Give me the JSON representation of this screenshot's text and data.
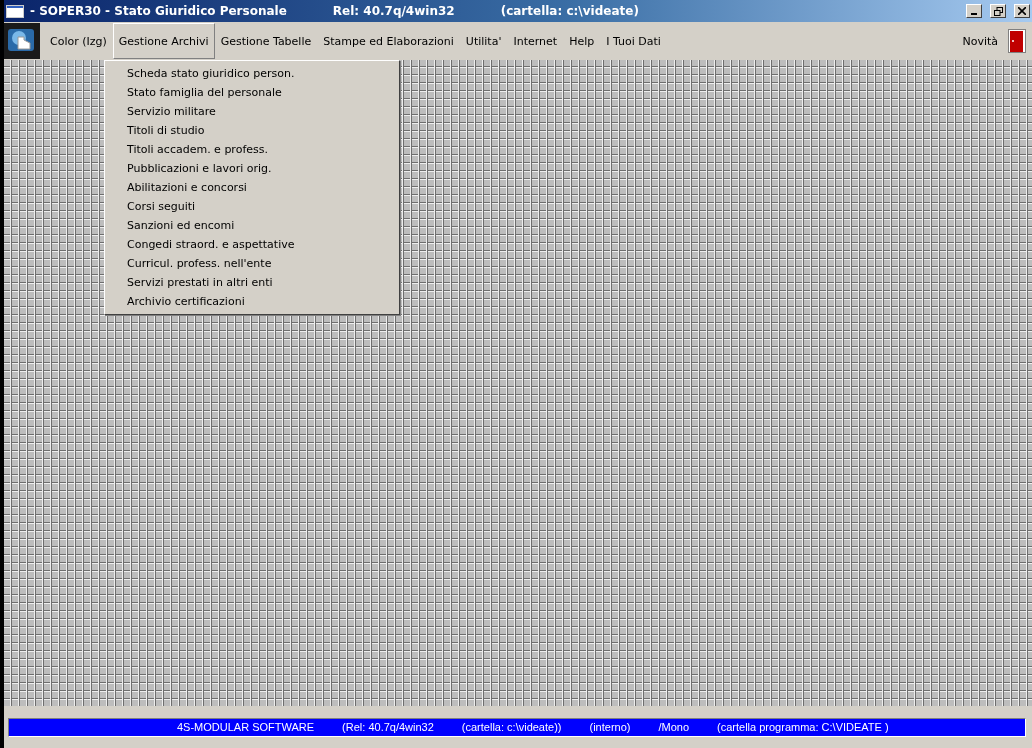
{
  "window": {
    "title": "- SOPER30 - Stato Giuridico Personale",
    "release": "Rel: 40.7q/4win32",
    "folder": "(cartella: c:\\videate)"
  },
  "menu": [
    {
      "label": "Color (Izg)",
      "selected": false
    },
    {
      "label": "Gestione Archivi",
      "selected": true
    },
    {
      "label": "Gestione Tabelle",
      "selected": false
    },
    {
      "label": "Stampe ed Elaborazioni",
      "selected": false
    },
    {
      "label": "Utilita'",
      "selected": false
    },
    {
      "label": "Internet",
      "selected": false
    },
    {
      "label": "Help",
      "selected": false
    },
    {
      "label": "I Tuoi Dati",
      "selected": false
    }
  ],
  "menu_right": "Novità",
  "dropdown": [
    "Scheda stato giuridico person.",
    "Stato famiglia del personale",
    "Servizio militare",
    "Titoli di studio",
    "Titoli accadem. e profess.",
    "Pubblicazioni e lavori orig.",
    "Abilitazioni e concorsi",
    "Corsi seguiti",
    "Sanzioni ed encomi",
    "Congedi straord. e aspettative",
    "Curricul. profess. nell'ente",
    "Servizi prestati in altri enti",
    "Archivio certificazioni"
  ],
  "status_bar": [
    "4S-MODULAR SOFTWARE",
    "(Rel: 40.7q/4win32",
    "(cartella: c:\\videate))",
    "(interno)",
    "/Mono",
    "(cartella programma: C:\\VIDEATE )"
  ]
}
